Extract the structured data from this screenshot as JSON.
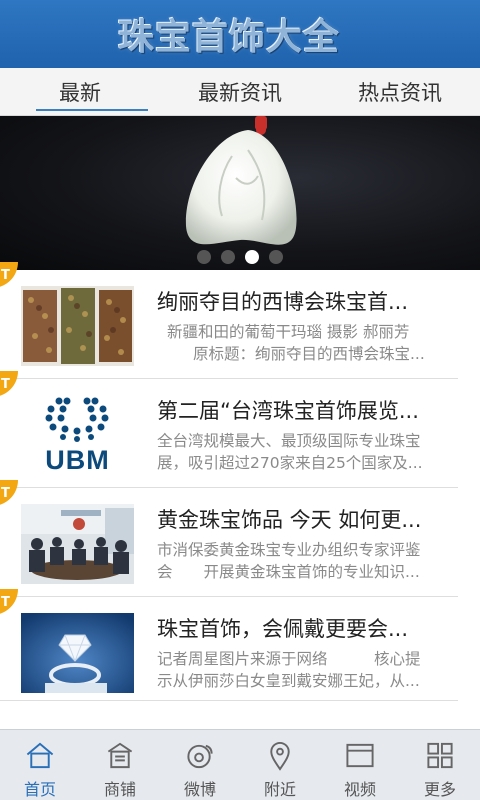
{
  "app": {
    "title": "珠宝首饰大全"
  },
  "tabs": [
    {
      "label": "最新",
      "active": true
    },
    {
      "label": "最新资讯",
      "active": false
    },
    {
      "label": "热点资讯",
      "active": false
    }
  ],
  "banner": {
    "total_slides": 4,
    "active_slide": 3
  },
  "articles": [
    {
      "badge": "T",
      "title": "绚丽夺目的西博会珠宝首...",
      "desc_line1": "新疆和田的葡萄干玛瑙 摄影 郝丽芳",
      "desc_line2": "原标题：绚丽夺目的西博会珠宝...",
      "thumb": "gemstones"
    },
    {
      "badge": "T",
      "title": "第二届“台湾珠宝首饰展览...",
      "desc_line1": "全台湾规模最大、最顶级国际专业珠宝",
      "desc_line2": "展，吸引超过270家来自25个国家及...",
      "thumb": "ubm-logo",
      "thumb_text": "UBM"
    },
    {
      "badge": "T",
      "title": "黄金珠宝饰品 今天 如何更...",
      "desc_line1": "市消保委黄金珠宝专业办组织专家评鉴",
      "desc_line2": "会　　开展黄金珠宝首饰的专业知识...",
      "thumb": "meeting"
    },
    {
      "badge": "T",
      "title": "珠宝首饰，会佩戴更要会...",
      "desc_line1": "记者周星图片来源于网络　　　核心提",
      "desc_line2": "示从伊丽莎白女皇到戴安娜王妃，从...",
      "thumb": "diamond-ring"
    }
  ],
  "bottom_nav": [
    {
      "label": "首页",
      "icon": "home-icon",
      "active": true
    },
    {
      "label": "商铺",
      "icon": "shop-icon",
      "active": false
    },
    {
      "label": "微博",
      "icon": "weibo-icon",
      "active": false
    },
    {
      "label": "附近",
      "icon": "location-icon",
      "active": false
    },
    {
      "label": "视频",
      "icon": "video-icon",
      "active": false
    },
    {
      "label": "更多",
      "icon": "more-grid-icon",
      "active": false
    }
  ],
  "colors": {
    "header": "#2f77c2",
    "accent": "#2a6fb8",
    "badge": "#f2a713"
  }
}
